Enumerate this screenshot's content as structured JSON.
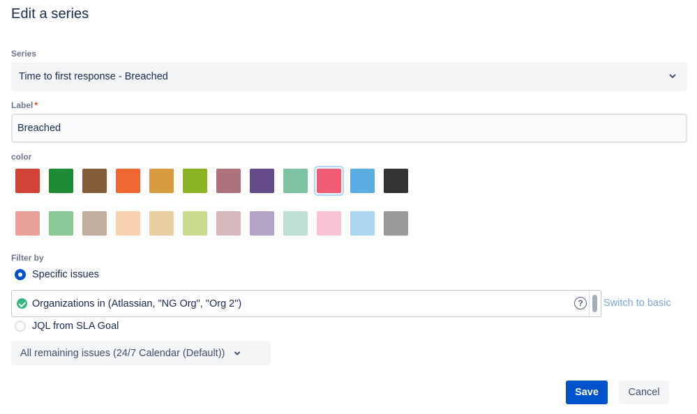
{
  "dialog": {
    "title": "Edit a series"
  },
  "series": {
    "label": "Series",
    "selected": "Time to first response - Breached"
  },
  "label_field": {
    "label": "Label",
    "required_marker": "*",
    "value": "Breached"
  },
  "color": {
    "label": "color",
    "selected_index": 9,
    "row1": [
      "#d04437",
      "#1e8c35",
      "#845c3a",
      "#ed6832",
      "#d89c40",
      "#8ab325",
      "#ad727b",
      "#654a8a",
      "#7dc2a2",
      "#f15c75",
      "#5aade1",
      "#333333"
    ],
    "row2": [
      "#e8a299",
      "#8cc797",
      "#c1ae9d",
      "#f8d2b0",
      "#e9cf9f",
      "#c8db8e",
      "#d6b9bd",
      "#b3a3c4",
      "#bee0d2",
      "#f9c5d5",
      "#acd6f0",
      "#999999"
    ]
  },
  "filter": {
    "label": "Filter by",
    "option_specific": "Specific issues",
    "jql_query": "Organizations in (Atlassian, \"NG Org\", \"Org 2\")",
    "help_glyph": "?",
    "switch_link": "Switch to basic",
    "option_jql": "JQL from SLA Goal"
  },
  "calendar": {
    "selected": "All remaining issues (24/7 Calendar (Default))"
  },
  "actions": {
    "save": "Save",
    "cancel": "Cancel"
  }
}
